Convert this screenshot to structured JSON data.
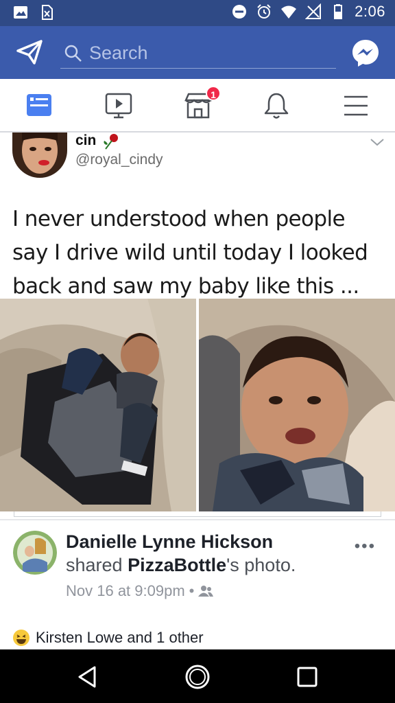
{
  "status_bar": {
    "time": "2:06",
    "left_icons": [
      "gallery-icon",
      "sim-x-icon"
    ],
    "right_icons": [
      "do-not-disturb-icon",
      "alarm-icon",
      "wifi-icon",
      "no-signal-icon",
      "battery-icon"
    ]
  },
  "header": {
    "search_placeholder": "Search",
    "left_icon": "paper-plane-icon",
    "right_icon": "messenger-icon",
    "color": "#3b5bac"
  },
  "nav_tabs": [
    {
      "name": "news-feed",
      "icon": "news-feed-icon",
      "active": true
    },
    {
      "name": "watch",
      "icon": "video-icon",
      "active": false
    },
    {
      "name": "marketplace",
      "icon": "marketplace-icon",
      "badge": "1",
      "active": false
    },
    {
      "name": "notifications",
      "icon": "bell-icon",
      "active": false
    },
    {
      "name": "menu",
      "icon": "hamburger-icon",
      "active": false
    }
  ],
  "tweet": {
    "name": "cin",
    "handle": "@royal_cindy",
    "text": "I never understood when people say I drive wild until today I looked back and saw my baby like this ..."
  },
  "shared_post": {
    "author": "Danielle Lynne Hickson",
    "action_prefix": "shared",
    "page_name": "PizzaBottle",
    "action_suffix": "'s photo.",
    "timestamp": "Nov 16 at 9:09pm",
    "separator": "•",
    "more": "•••"
  },
  "reactions": {
    "emoji": "haha-icon",
    "text": "Kirsten Lowe and 1 other"
  },
  "android_nav": [
    "back-icon",
    "home-icon",
    "recents-icon"
  ]
}
